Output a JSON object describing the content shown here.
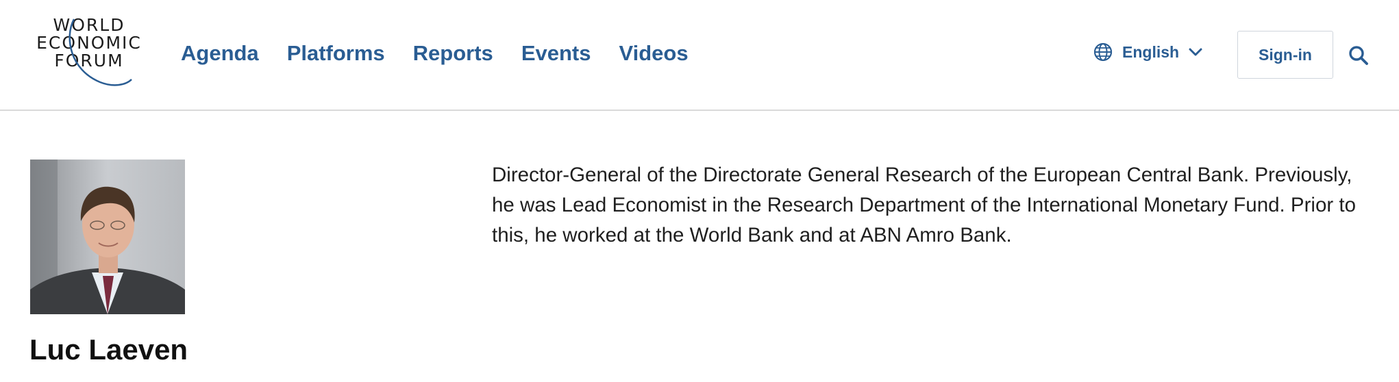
{
  "header": {
    "logo": {
      "lines": [
        "WORLD",
        "ECONOMIC",
        "FORUM"
      ],
      "icon": "wef-logo-arc"
    },
    "nav": [
      {
        "label": "Agenda"
      },
      {
        "label": "Platforms"
      },
      {
        "label": "Reports"
      },
      {
        "label": "Events"
      },
      {
        "label": "Videos"
      }
    ],
    "language": {
      "icon": "globe-icon",
      "label": "English",
      "dropdown_icon": "chevron-down-icon"
    },
    "signin_label": "Sign-in",
    "search_icon": "search-icon"
  },
  "profile": {
    "photo": "portrait-photo",
    "name": "Luc Laeven",
    "bio": "Director-General of the Directorate General Research of the European Central Bank. Previously, he was Lead Economist in the Research Department of the International Monetary Fund. Prior to this, he worked at the World Bank and at ABN Amro Bank."
  },
  "colors": {
    "brand_blue": "#2a5d93",
    "divider": "#d9d9d9"
  }
}
